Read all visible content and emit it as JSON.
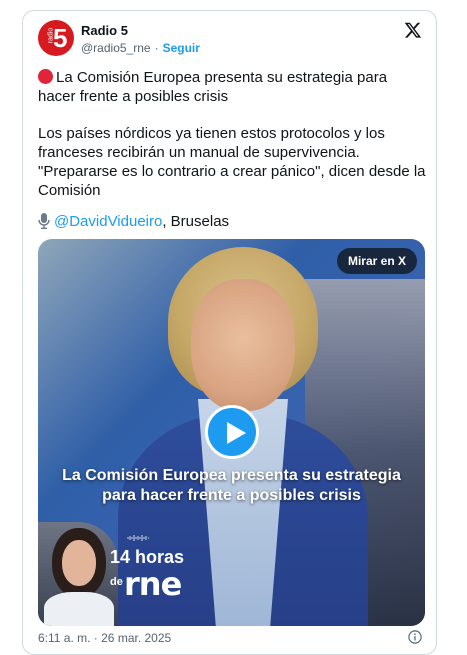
{
  "account": {
    "name": "Radio 5",
    "handle": "@radio5_rne",
    "separator": "·",
    "follow_label": "Seguir",
    "avatar": {
      "small_text": "radio",
      "big_text": "5",
      "color": "#d71920"
    }
  },
  "tweet": {
    "line1_text": "La Comisión Europea presenta su estrategia para hacer frente a posibles crisis",
    "paragraph2": "Los países nórdicos ya tienen estos protocolos y los franceses recibirán un manual de supervivencia. \"Prepararse es lo contrario a crear pánico\", dicen desde la Comisión",
    "mention": "@DavidVidueiro",
    "mention_suffix": ", Bruselas",
    "icons": {
      "bullet": "red-circle-icon",
      "mic": "microphone-icon"
    }
  },
  "media": {
    "watch_label": "Mirar en X",
    "caption": "La Comisión Europea presenta su estrategia para hacer frente a posibles crisis",
    "show": {
      "title_line": "14 horas",
      "prefix": "de",
      "brand": "rne"
    }
  },
  "footer": {
    "timestamp": "6:11 a. m. · 26 mar. 2025"
  },
  "colors": {
    "link": "#1d9bf0",
    "muted": "#536471",
    "border": "#cfd9de"
  }
}
